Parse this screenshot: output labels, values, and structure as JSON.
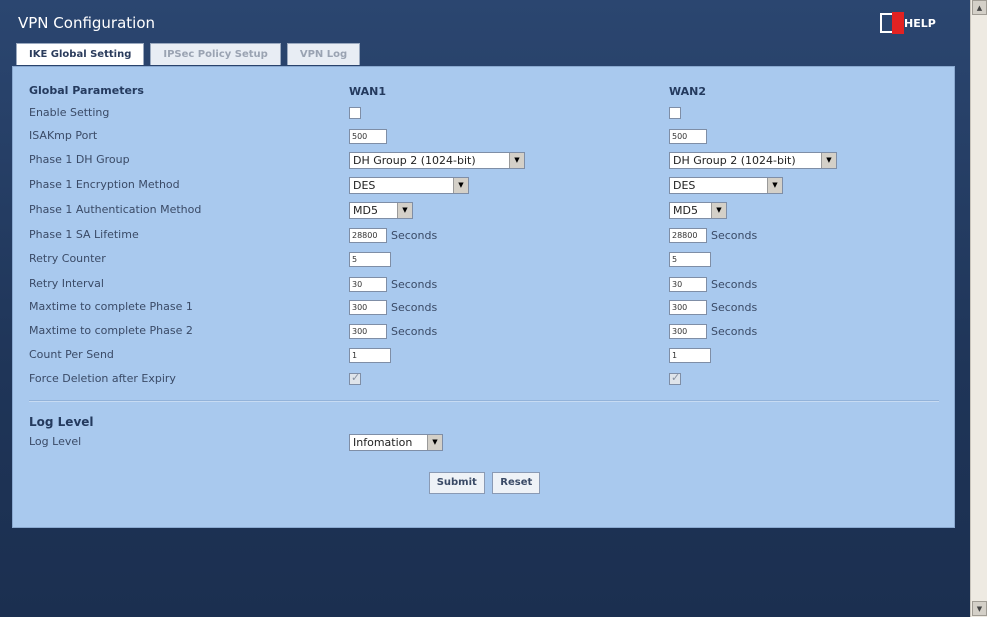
{
  "window": {
    "title": "VPN Configuration",
    "help_label": "HELP"
  },
  "tabs": [
    {
      "label": "IKE Global Setting",
      "active": true
    },
    {
      "label": "IPSec Policy Setup",
      "active": false
    },
    {
      "label": "VPN Log",
      "active": false
    }
  ],
  "global": {
    "header": "Global Parameters",
    "wan1": "WAN1",
    "wan2": "WAN2",
    "rows": {
      "enable": {
        "label": "Enable Setting"
      },
      "isakmp": {
        "label": "ISAKmp Port",
        "wan1": "500",
        "wan2": "500"
      },
      "dh": {
        "label": "Phase 1 DH Group",
        "wan1": "DH Group 2 (1024-bit)",
        "wan2": "DH Group 2 (1024-bit)"
      },
      "enc": {
        "label": "Phase 1 Encryption Method",
        "wan1": "DES",
        "wan2": "DES"
      },
      "auth": {
        "label": "Phase 1 Authentication Method",
        "wan1": "MD5",
        "wan2": "MD5"
      },
      "lifetime": {
        "label": "Phase 1 SA Lifetime",
        "wan1": "28800",
        "wan2": "28800",
        "unit": "Seconds"
      },
      "retry_count": {
        "label": "Retry Counter",
        "wan1": "5",
        "wan2": "5"
      },
      "retry_int": {
        "label": "Retry Interval",
        "wan1": "30",
        "wan2": "30",
        "unit": "Seconds"
      },
      "max1": {
        "label": "Maxtime to complete Phase 1",
        "wan1": "300",
        "wan2": "300",
        "unit": "Seconds"
      },
      "max2": {
        "label": "Maxtime to complete Phase 2",
        "wan1": "300",
        "wan2": "300",
        "unit": "Seconds"
      },
      "count": {
        "label": "Count Per Send",
        "wan1": "1",
        "wan2": "1"
      },
      "force": {
        "label": "Force Deletion after Expiry"
      }
    }
  },
  "log": {
    "header": "Log Level",
    "label": "Log Level",
    "value": "Infomation"
  },
  "buttons": {
    "submit": "Submit",
    "reset": "Reset"
  },
  "colors": {
    "panel": "#a9c9ee",
    "background": "#233a5e",
    "help_accent": "#e22222"
  }
}
